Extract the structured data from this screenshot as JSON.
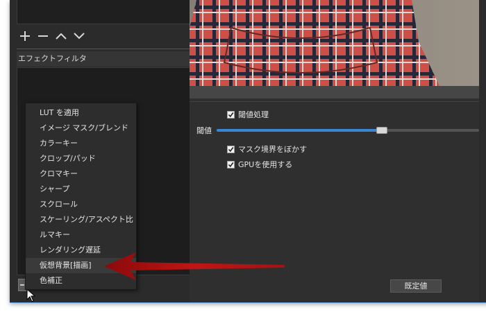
{
  "filters_panel": {
    "header": "エフェクトフィルタ"
  },
  "context_menu": {
    "items": [
      {
        "label": "LUT を適用"
      },
      {
        "label": "イメージ マスク/ブレンド"
      },
      {
        "label": "カラーキー"
      },
      {
        "label": "クロップ/パッド"
      },
      {
        "label": "クロマキー"
      },
      {
        "label": "シャープ"
      },
      {
        "label": "スクロール"
      },
      {
        "label": "スケーリング/アスペクト比"
      },
      {
        "label": "ルマキー"
      },
      {
        "label": "レンダリング遅延"
      },
      {
        "label": "仮想背景[描画]",
        "highlighted": true
      },
      {
        "label": "色補正"
      }
    ]
  },
  "properties": {
    "threshold_check": {
      "label": "閾値処理",
      "checked": true
    },
    "slider": {
      "label": "閾値",
      "value_fraction": 0.63
    },
    "blur_check": {
      "label": "マスク境界をぼかす",
      "checked": true
    },
    "gpu_check": {
      "label": "GPUを使用する",
      "checked": true
    },
    "default_button": "既定値"
  },
  "colors": {
    "accent": "#3a86d6",
    "arrow": "#b01010"
  },
  "icons": {
    "add": "plus-icon",
    "remove": "minus-icon",
    "up": "chevron-up-icon",
    "down": "chevron-down-icon"
  }
}
